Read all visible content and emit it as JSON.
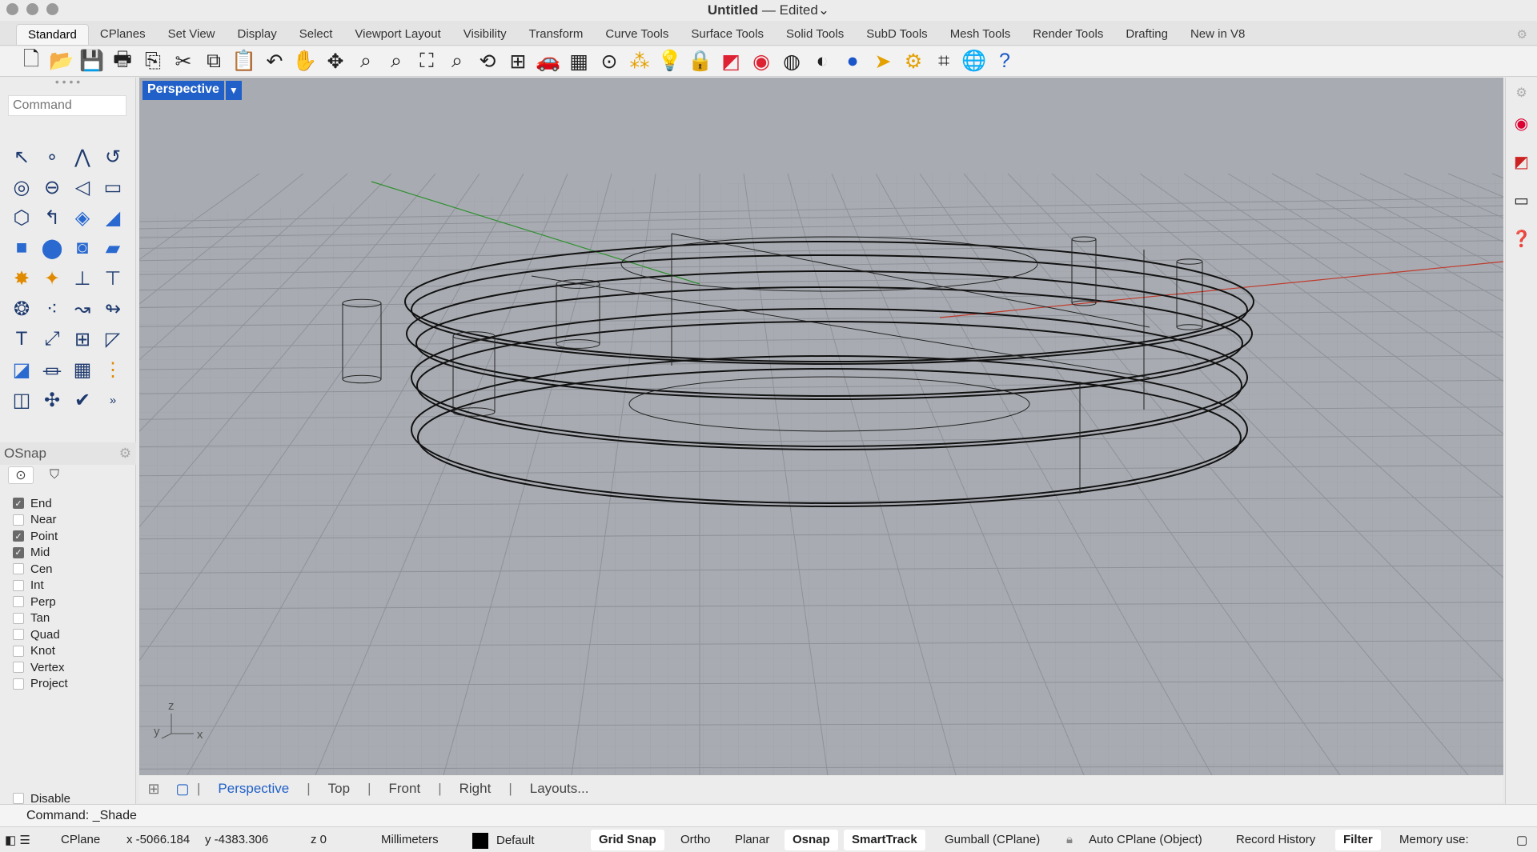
{
  "window": {
    "title": "Untitled",
    "separator": "—",
    "edited": "Edited⌄"
  },
  "tabs": [
    "Standard",
    "CPlanes",
    "Set View",
    "Display",
    "Select",
    "Viewport Layout",
    "Visibility",
    "Transform",
    "Curve Tools",
    "Surface Tools",
    "Solid Tools",
    "SubD Tools",
    "Mesh Tools",
    "Render Tools",
    "Drafting",
    "New in V8"
  ],
  "toolbar_icons": [
    "new-icon",
    "open-icon",
    "save-icon",
    "print-icon",
    "import-icon",
    "cut-icon",
    "copy-icon",
    "paste-icon",
    "undo-icon",
    "pan-hand-icon",
    "rotate-view-icon",
    "zoom-icon",
    "zoom-window-icon",
    "zoom-extents-icon",
    "zoom-selected-icon",
    "rotate-camera-icon",
    "viewport-layout-icon",
    "car-icon",
    "cplane-grid-icon",
    "osnap-icon",
    "points-icon",
    "light-bulb-icon",
    "lock-icon",
    "layers-icon",
    "color-wheel-icon",
    "sphere-wire-icon",
    "sphere-shaded-icon",
    "sphere-render-icon",
    "flamingo-icon",
    "gear-options-icon",
    "grasshopper-icon",
    "globe-icon",
    "help-icon"
  ],
  "command": {
    "placeholder": "Command",
    "last": "Command: _Shade"
  },
  "osnap": {
    "title": "OSnap",
    "items": [
      {
        "label": "End",
        "checked": true
      },
      {
        "label": "Near",
        "checked": false
      },
      {
        "label": "Point",
        "checked": true
      },
      {
        "label": "Mid",
        "checked": true
      },
      {
        "label": "Cen",
        "checked": false
      },
      {
        "label": "Int",
        "checked": false
      },
      {
        "label": "Perp",
        "checked": false
      },
      {
        "label": "Tan",
        "checked": false
      },
      {
        "label": "Quad",
        "checked": false
      },
      {
        "label": "Knot",
        "checked": false
      },
      {
        "label": "Vertex",
        "checked": false
      },
      {
        "label": "Project",
        "checked": false
      }
    ],
    "disable_label": "Disable"
  },
  "viewport": {
    "name": "Perspective",
    "axis_z": "z",
    "axis_y": "y",
    "axis_x": "x",
    "background": "#a8acb2"
  },
  "viewport_tabs": [
    "Perspective",
    "Top",
    "Front",
    "Right",
    "Layouts..."
  ],
  "status": {
    "cplane": "CPlane",
    "x": "x -5066.184",
    "y": "y -4383.306",
    "z": "z 0",
    "units": "Millimeters",
    "layer": "Default",
    "grid_snap": "Grid Snap",
    "ortho": "Ortho",
    "planar": "Planar",
    "osnap": "Osnap",
    "smarttrack": "SmartTrack",
    "gumball": "Gumball (CPlane)",
    "auto_cplane": "Auto CPlane (Object)",
    "record_history": "Record History",
    "filter": "Filter",
    "memory": "Memory use:"
  }
}
